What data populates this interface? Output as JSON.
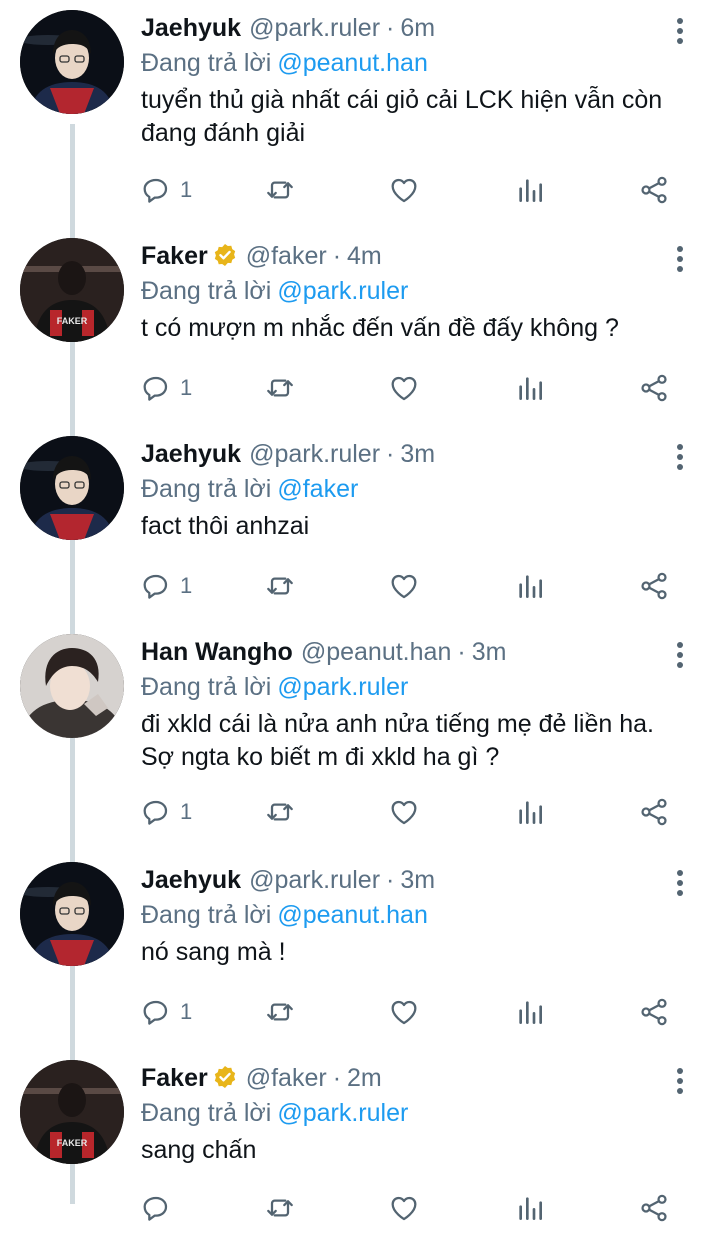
{
  "tweets": [
    {
      "name": "Jaehyuk",
      "verified": false,
      "handle": "@park.ruler",
      "time": "6m",
      "reply_prefix": "Đang trả lời",
      "reply_to": "@peanut.han",
      "text": "tuyển thủ già nhất cái giỏ cải LCK hiện vẫn còn đang đánh giải",
      "reply_count": "1",
      "avatar": "jaehyuk"
    },
    {
      "name": "Faker",
      "verified": true,
      "handle": "@faker",
      "time": "4m",
      "reply_prefix": "Đang trả lời",
      "reply_to": "@park.ruler",
      "text": "t có mượn m nhắc đến vấn đề đấy không ?",
      "reply_count": "1",
      "avatar": "faker"
    },
    {
      "name": "Jaehyuk",
      "verified": false,
      "handle": "@park.ruler",
      "time": "3m",
      "reply_prefix": "Đang trả lời",
      "reply_to": "@faker",
      "text": "fact thôi anhzai",
      "reply_count": "1",
      "avatar": "jaehyuk"
    },
    {
      "name": "Han Wangho",
      "verified": false,
      "handle": "@peanut.han",
      "time": "3m",
      "reply_prefix": "Đang trả lời",
      "reply_to": "@park.ruler",
      "text": "đi xkld cái là nửa anh nửa tiếng mẹ đẻ liền ha. Sợ ngta ko biết m đi xkld ha gì ?",
      "reply_count": "1",
      "avatar": "peanut"
    },
    {
      "name": "Jaehyuk",
      "verified": false,
      "handle": "@park.ruler",
      "time": "3m",
      "reply_prefix": "Đang trả lời",
      "reply_to": "@peanut.han",
      "text": "nó sang mà !",
      "reply_count": "1",
      "avatar": "jaehyuk"
    },
    {
      "name": "Faker",
      "verified": true,
      "handle": "@faker",
      "time": "2m",
      "reply_prefix": "Đang trả lời",
      "reply_to": "@park.ruler",
      "text": "sang chấn",
      "reply_count": "",
      "avatar": "faker"
    }
  ],
  "icons": {
    "reply": "reply-icon",
    "retweet": "retweet-icon",
    "like": "heart-icon",
    "analytics": "analytics-icon",
    "share": "share-icon",
    "more": "more-vertical-icon",
    "verified": "verified-badge-icon"
  },
  "colors": {
    "link": "#1d9bf0",
    "secondary_text": "#5b7083",
    "icon": "#536471",
    "verified": "#e8b51a",
    "thread_line": "#cfd9de"
  }
}
